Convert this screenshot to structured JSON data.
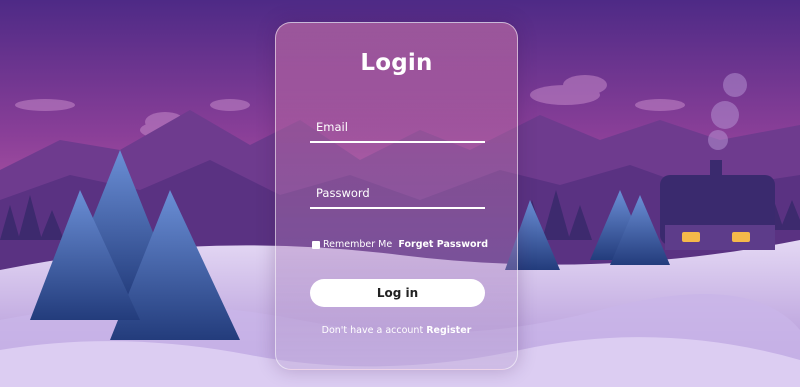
{
  "login": {
    "title": "Login",
    "email_placeholder": "Email",
    "password_placeholder": "Password",
    "remember_label": "Remember Me",
    "forget_label": "Forget Password",
    "button_label": "Log in",
    "no_account_text": "Don't have a account",
    "register_label": "Register"
  },
  "colors": {
    "sky_top": "#5b2a8a",
    "sky_mid": "#9b4a9e",
    "snow": "#d9c9ee",
    "button_bg": "#ffffff",
    "text": "#ffffff"
  }
}
